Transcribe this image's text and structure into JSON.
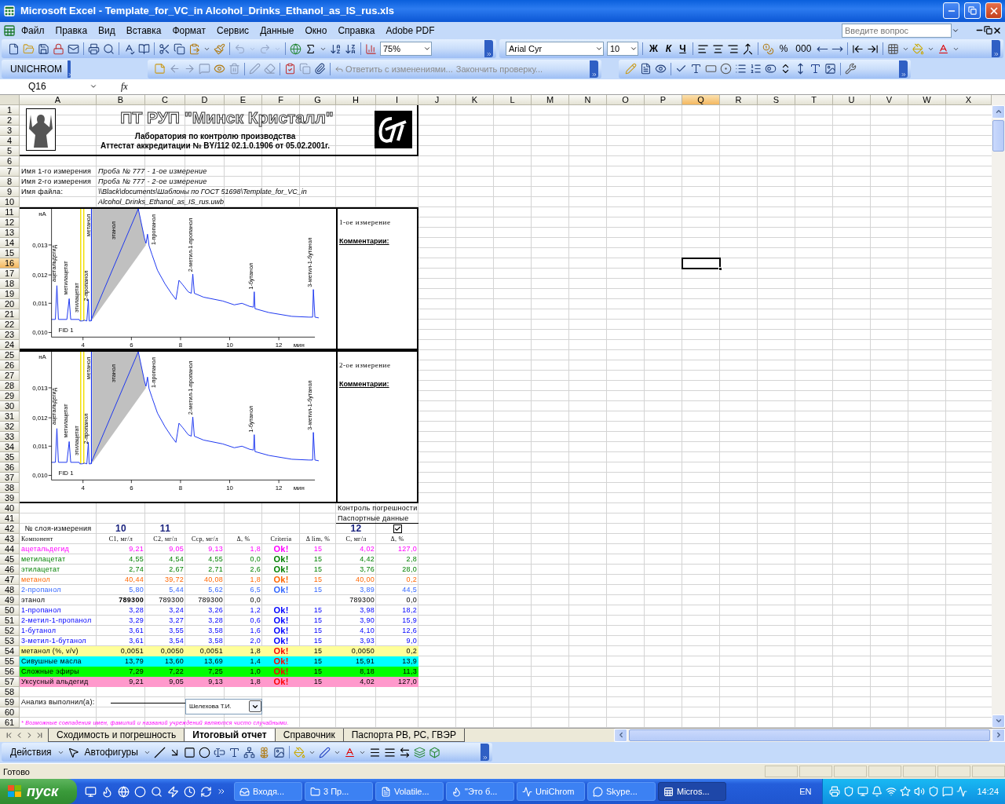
{
  "window": {
    "title": "Microsoft Excel - Template_for_VC_in Alcohol_Drinks_Ethanol_as_IS_rus.xls"
  },
  "menu": [
    "Файл",
    "Правка",
    "Вид",
    "Вставка",
    "Формат",
    "Сервис",
    "Данные",
    "Окно",
    "Справка",
    "Adobe PDF"
  ],
  "help_search": {
    "placeholder": "Введите вопрос"
  },
  "standard_toolbar": {
    "zoom": "75%"
  },
  "formatting_toolbar": {
    "font": "Arial Cyr",
    "size": "10",
    "bold": "Ж",
    "italic": "К",
    "underline": "Ч",
    "percent": "%",
    "thousands": "000"
  },
  "unichrom_toolbar": {
    "label": "UNICHROM"
  },
  "reviewing_toolbar": {
    "reply": "Ответить с изменениями...",
    "end_review": "Закончить проверку..."
  },
  "formula_bar": {
    "name_box": "Q16",
    "fx": "fx"
  },
  "sheet": {
    "columns": [
      {
        "label": "A",
        "selected": false
      },
      {
        "label": "B",
        "selected": false
      },
      {
        "label": "C",
        "selected": false
      },
      {
        "label": "D",
        "selected": false
      },
      {
        "label": "E",
        "selected": false
      },
      {
        "label": "F",
        "selected": false
      },
      {
        "label": "G",
        "selected": false
      },
      {
        "label": "H",
        "selected": false
      },
      {
        "label": "I",
        "selected": false
      },
      {
        "label": "J",
        "selected": false
      },
      {
        "label": "K",
        "selected": false
      },
      {
        "label": "L",
        "selected": false
      },
      {
        "label": "M",
        "selected": false
      },
      {
        "label": "N",
        "selected": false
      },
      {
        "label": "O",
        "selected": false
      },
      {
        "label": "P",
        "selected": false
      },
      {
        "label": "Q",
        "selected": true
      },
      {
        "label": "R",
        "selected": false
      },
      {
        "label": "S",
        "selected": false
      },
      {
        "label": "T",
        "selected": false
      },
      {
        "label": "U",
        "selected": false
      },
      {
        "label": "V",
        "selected": false
      },
      {
        "label": "W",
        "selected": false
      },
      {
        "label": "X",
        "selected": false
      }
    ],
    "rows": [
      {
        "label": "1",
        "selected": false
      },
      {
        "label": "2",
        "selected": false
      },
      {
        "label": "3",
        "selected": false
      },
      {
        "label": "4",
        "selected": false
      },
      {
        "label": "5",
        "selected": false
      },
      {
        "label": "6",
        "selected": false
      },
      {
        "label": "7",
        "selected": false
      },
      {
        "label": "8",
        "selected": false
      },
      {
        "label": "9",
        "selected": false
      },
      {
        "label": "10",
        "selected": false
      },
      {
        "label": "11",
        "selected": false
      },
      {
        "label": "12",
        "selected": false
      },
      {
        "label": "13",
        "selected": false
      },
      {
        "label": "14",
        "selected": false
      },
      {
        "label": "15",
        "selected": false
      },
      {
        "label": "16",
        "selected": true
      },
      {
        "label": "17",
        "selected": false
      },
      {
        "label": "18",
        "selected": false
      },
      {
        "label": "19",
        "selected": false
      },
      {
        "label": "20",
        "selected": false
      },
      {
        "label": "21",
        "selected": false
      },
      {
        "label": "22",
        "selected": false
      },
      {
        "label": "23",
        "selected": false
      },
      {
        "label": "24",
        "selected": false
      },
      {
        "label": "25",
        "selected": false
      },
      {
        "label": "26",
        "selected": false
      },
      {
        "label": "27",
        "selected": false
      },
      {
        "label": "28",
        "selected": false
      },
      {
        "label": "29",
        "selected": false
      },
      {
        "label": "30",
        "selected": false
      },
      {
        "label": "31",
        "selected": false
      },
      {
        "label": "32",
        "selected": false
      },
      {
        "label": "33",
        "selected": false
      },
      {
        "label": "34",
        "selected": false
      },
      {
        "label": "35",
        "selected": false
      },
      {
        "label": "36",
        "selected": false
      },
      {
        "label": "37",
        "selected": false
      },
      {
        "label": "38",
        "selected": false
      },
      {
        "label": "39",
        "selected": false
      },
      {
        "label": "40",
        "selected": false
      },
      {
        "label": "41",
        "selected": false
      },
      {
        "label": "42",
        "selected": false
      },
      {
        "label": "43",
        "selected": false
      },
      {
        "label": "44",
        "selected": false
      },
      {
        "label": "45",
        "selected": false
      },
      {
        "label": "46",
        "selected": false
      },
      {
        "label": "47",
        "selected": false
      },
      {
        "label": "48",
        "selected": false
      },
      {
        "label": "49",
        "selected": false
      },
      {
        "label": "50",
        "selected": false
      },
      {
        "label": "51",
        "selected": false
      },
      {
        "label": "52",
        "selected": false
      },
      {
        "label": "53",
        "selected": false
      },
      {
        "label": "54",
        "selected": false
      },
      {
        "label": "55",
        "selected": false
      },
      {
        "label": "56",
        "selected": false
      },
      {
        "label": "57",
        "selected": false
      },
      {
        "label": "58",
        "selected": false
      },
      {
        "label": "59",
        "selected": false
      },
      {
        "label": "60",
        "selected": false
      },
      {
        "label": "61",
        "selected": false
      }
    ]
  },
  "header": {
    "company": "ПТ РУП \"Минск Кристалл\"",
    "lab": "Лаборатория по контролю производства",
    "certificate": "Аттестат аккредитации № BY/112 02.1.0.1906 от 05.02.2001г."
  },
  "info": [
    {
      "label": "Имя 1-го измерения",
      "value": "Проба № 777 - 1-ое измерение"
    },
    {
      "label": "Имя 2-го измерения",
      "value": "Проба № 777 - 2-ое измерение"
    },
    {
      "label": "Имя файла:",
      "value": "\\\\Black\\documents\\Шаблоны по ГОСТ 51698\\Template_for_VC_in Alcohol_Drinks_Ethanol_as_IS_rus.uwb"
    }
  ],
  "measurements": [
    {
      "title": "1-ое измерение",
      "comments": "Комментарии:",
      "chromatogram": {
        "y_unit": "нА",
        "x_unit": "мин",
        "detector": "FID 1",
        "yticks": [
          "0,013",
          "0,012",
          "0,011",
          "0,010"
        ],
        "xticks": [
          "4",
          "6",
          "8",
          "10",
          "12"
        ],
        "peaks": [
          "ацетальдегид",
          "метилацетат",
          "этилацетат",
          "метанол",
          "2-пропанол",
          "этанол",
          "1-пропанол",
          "2-метил-1-пропанол",
          "1-бутанол",
          "3-метил-1-бутанол"
        ]
      }
    },
    {
      "title": "2-ое измерение",
      "comments": "Комментарии:",
      "chromatogram": {
        "y_unit": "нА",
        "x_unit": "мин",
        "detector": "FID 1",
        "yticks": [
          "0,013",
          "0,012",
          "0,011",
          "0,010"
        ],
        "xticks": [
          "4",
          "6",
          "8",
          "10",
          "12"
        ],
        "peaks": [
          "ацетальдегид",
          "метилацетат",
          "этилацетат",
          "метанол",
          "2-пропанол",
          "этанол",
          "1-пропанол",
          "2-метил-1-пропанол",
          "1-бутанол",
          "3-метил-1-бутанол"
        ]
      }
    }
  ],
  "error_control": {
    "title": "Контроль погрешности",
    "passport": "Паспортные данные"
  },
  "results": {
    "layer_label": "№ слоя-измерения",
    "layers": [
      "10",
      "11"
    ],
    "passport_layer": "12",
    "passport_checked": true,
    "columns": [
      "Компонент",
      "C1, мг/л",
      "C2, мг/л",
      "Сср, мг/л",
      "Δ, %",
      "Criteria",
      "Δ lim, %",
      "C, мг/л",
      "Δ, %"
    ],
    "rows": [
      {
        "kind": "component",
        "color": "#ff00ff",
        "name": "ацетальдегид",
        "c1": "9,21",
        "c2": "9,05",
        "avg": "9,13",
        "delta": "1,8",
        "criteria": "Ok!",
        "limit": "15",
        "c": "4,02",
        "delta_passport": "127,0"
      },
      {
        "kind": "component",
        "color": "#008000",
        "name": "метилацетат",
        "c1": "4,55",
        "c2": "4,54",
        "avg": "4,55",
        "delta": "0,0",
        "criteria": "Ok!",
        "limit": "15",
        "c": "4,42",
        "delta_passport": "2,8"
      },
      {
        "kind": "component",
        "color": "#008000",
        "name": "этилацетат",
        "c1": "2,74",
        "c2": "2,67",
        "avg": "2,71",
        "delta": "2,6",
        "criteria": "Ok!",
        "limit": "15",
        "c": "3,76",
        "delta_passport": "28,0"
      },
      {
        "kind": "component",
        "color": "#ff6600",
        "name": "метанол",
        "c1": "40,44",
        "c2": "39,72",
        "avg": "40,08",
        "delta": "1,8",
        "criteria": "Ok!",
        "limit": "15",
        "c": "40,00",
        "delta_passport": "0,2"
      },
      {
        "kind": "component",
        "color": "#3366ff",
        "name": "2-пропанол",
        "c1": "5,80",
        "c2": "5,44",
        "avg": "5,62",
        "delta": "6,5",
        "criteria": "Ok!",
        "limit": "15",
        "c": "3,89",
        "delta_passport": "44,5"
      },
      {
        "kind": "component",
        "color": "#000000",
        "name": "этанол",
        "c1": "789300",
        "c2": "789300",
        "avg": "789300",
        "delta": "0,0",
        "c": "789300",
        "delta_passport": "0,0"
      },
      {
        "kind": "component",
        "color": "#0000ff",
        "name": "1-пропанол",
        "c1": "3,28",
        "c2": "3,24",
        "avg": "3,26",
        "delta": "1,2",
        "criteria": "Ok!",
        "limit": "15",
        "c": "3,98",
        "delta_passport": "18,2"
      },
      {
        "kind": "component",
        "color": "#0000ff",
        "name": "2-метил-1-пропанол",
        "c1": "3,29",
        "c2": "3,27",
        "avg": "3,28",
        "delta": "0,6",
        "criteria": "Ok!",
        "limit": "15",
        "c": "3,90",
        "delta_passport": "15,9"
      },
      {
        "kind": "component",
        "color": "#0000ff",
        "name": "1-бутанол",
        "c1": "3,61",
        "c2": "3,55",
        "avg": "3,58",
        "delta": "1,6",
        "criteria": "Ok!",
        "limit": "15",
        "c": "4,10",
        "delta_passport": "12,6"
      },
      {
        "kind": "component",
        "color": "#0000ff",
        "name": "3-метил-1-бутанол",
        "c1": "3,61",
        "c2": "3,54",
        "avg": "3,58",
        "delta": "2,0",
        "criteria": "Ok!",
        "limit": "15",
        "c": "3,93",
        "delta_passport": "9,0"
      },
      {
        "kind": "summary",
        "color": "#ffff99",
        "name": "метанол (%, v/v)",
        "c1": "0,0051",
        "c2": "0,0050",
        "avg": "0,0051",
        "delta": "1,8",
        "criteria": "Ok!",
        "limit": "15",
        "c": "0,0050",
        "delta_passport": "0,2"
      },
      {
        "kind": "summary",
        "color": "#00ffff",
        "name": "Сивушные масла",
        "c1": "13,79",
        "c2": "13,60",
        "avg": "13,69",
        "delta": "1,4",
        "criteria": "Ok!",
        "limit": "15",
        "c": "15,91",
        "delta_passport": "13,9"
      },
      {
        "kind": "summary",
        "color": "#00ff00",
        "name": "Сложные эфиры",
        "c1": "7,29",
        "c2": "7,22",
        "avg": "7,25",
        "delta": "1,0",
        "criteria": "Ok!",
        "limit": "15",
        "c": "8,18",
        "delta_passport": "11,3"
      },
      {
        "kind": "summary",
        "color": "#ff99cc",
        "name": "Уксусный альдегид",
        "c1": "9,21",
        "c2": "9,05",
        "avg": "9,13",
        "delta": "1,8",
        "criteria": "Ok!",
        "limit": "15",
        "c": "4,02",
        "delta_passport": "127,0"
      }
    ]
  },
  "signature": {
    "label": "Анализ выполнил(а):",
    "analyst": "Шелехова Т.И."
  },
  "footnote": "* Возможные совпадения имен, фамилий и названий учреждений являются чисто случайными.",
  "sheet_tabs": [
    {
      "label": "Сходимость и погрешность",
      "selected": false
    },
    {
      "label": "Итоговый отчет",
      "selected": true
    },
    {
      "label": "Справочник",
      "selected": false
    },
    {
      "label": "Паспорта РВ, РС, ГВЭР",
      "selected": false
    }
  ],
  "drawing_toolbar": {
    "actions": "Действия",
    "autoshapes": "Автофигуры"
  },
  "status_bar": {
    "text": "Готово"
  },
  "taskbar": {
    "start": "пуск",
    "tasks": [
      {
        "label": "Входя...",
        "selected": false
      },
      {
        "label": "3 Пр...",
        "selected": false
      },
      {
        "label": "Volatile...",
        "selected": false
      },
      {
        "label": "\"Это б...",
        "selected": false
      },
      {
        "label": "UniChrom",
        "selected": false
      },
      {
        "label": "Skype...",
        "selected": false
      },
      {
        "label": "Micros...",
        "selected": true
      }
    ],
    "language": "EN",
    "clock": "14:24"
  }
}
